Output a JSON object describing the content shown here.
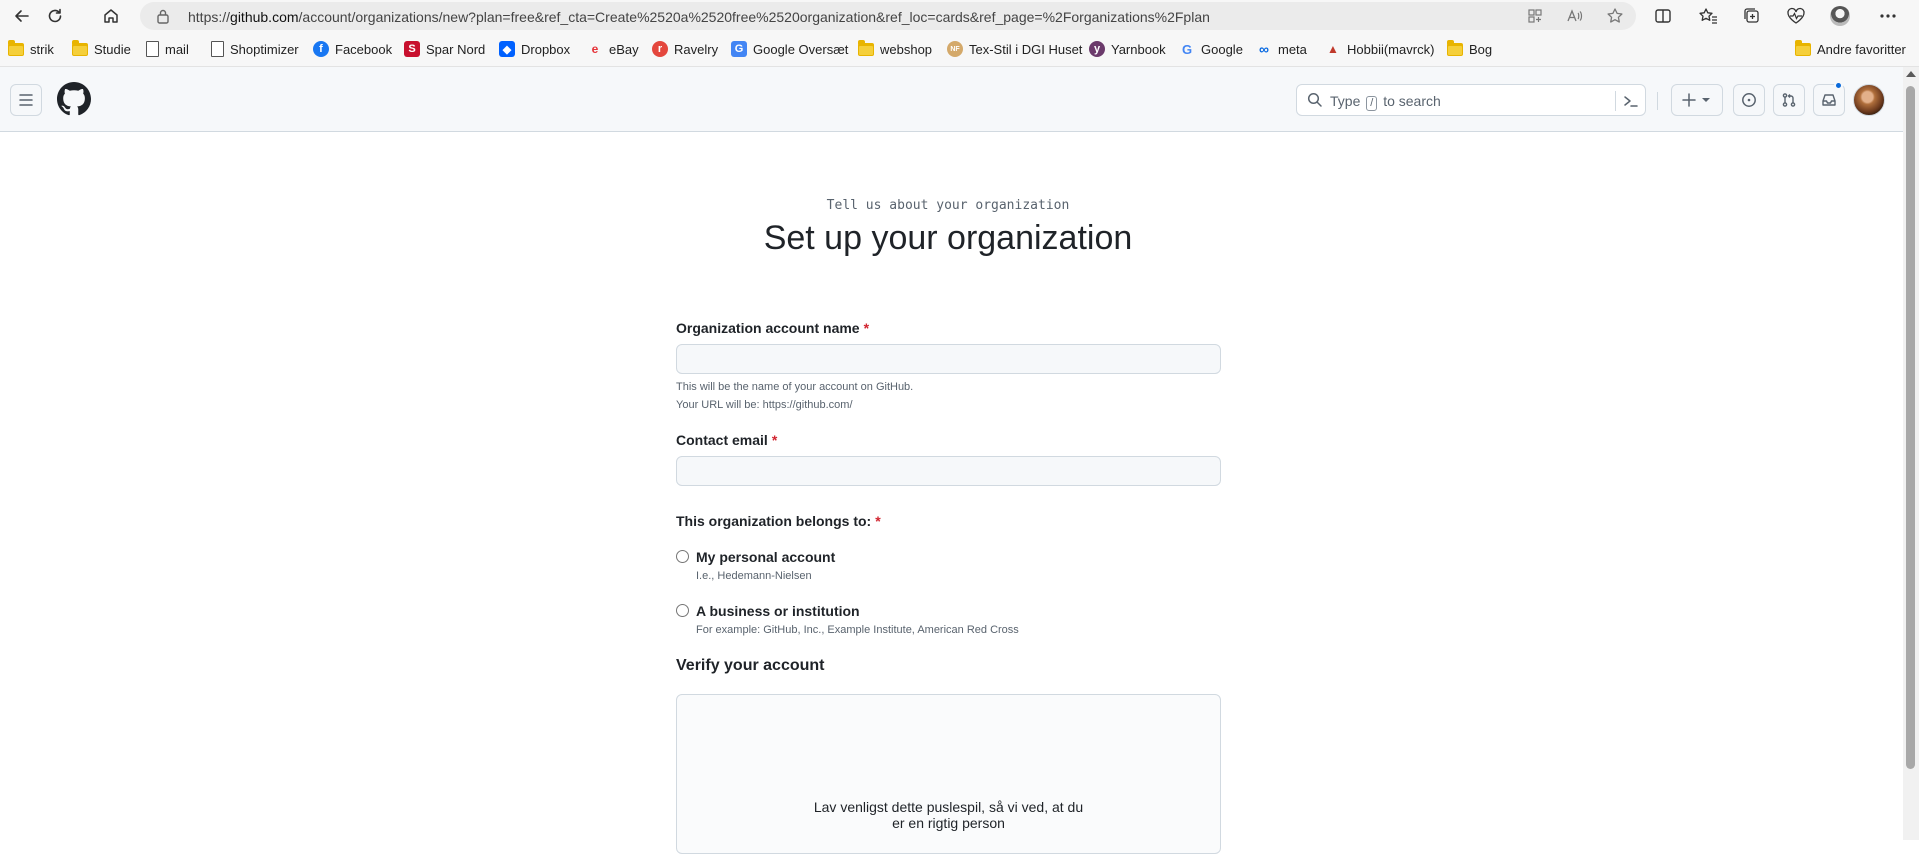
{
  "browser": {
    "url_prefix": "https://",
    "url_host": "github.com",
    "url_path": "/account/organizations/new?plan=free&ref_cta=Create%2520a%2520free%2520organization&ref_loc=cards&ref_page=%2Forganizations%2Fplan",
    "bookmarks": [
      {
        "label": "strik",
        "icon": "folder-icon"
      },
      {
        "label": "Studie",
        "icon": "folder-icon"
      },
      {
        "label": "mail",
        "icon": "page-icon"
      },
      {
        "label": "Shoptimizer",
        "icon": "page-icon"
      },
      {
        "label": "Facebook",
        "icon": "facebook-icon",
        "color": "#1877f2"
      },
      {
        "label": "Spar Nord",
        "icon": "sparnord-icon",
        "color": "#c8102e"
      },
      {
        "label": "Dropbox",
        "icon": "dropbox-icon",
        "color": "#0061ff"
      },
      {
        "label": "eBay",
        "icon": "ebay-icon"
      },
      {
        "label": "Ravelry",
        "icon": "ravelry-icon",
        "color": "#e4473d"
      },
      {
        "label": "Google Oversæt",
        "icon": "google-translate-icon",
        "color": "#4285f4"
      },
      {
        "label": "webshop",
        "icon": "folder-icon"
      },
      {
        "label": "Tex-Stil i DGI Huset",
        "icon": "texstil-icon",
        "color": "#d4a96a"
      },
      {
        "label": "Yarnbook",
        "icon": "yarnbook-icon",
        "color": "#6b3a6b"
      },
      {
        "label": "Google",
        "icon": "google-icon"
      },
      {
        "label": "meta",
        "icon": "meta-icon",
        "color": "#0668e1"
      },
      {
        "label": "Hobbii(mavrck)",
        "icon": "hobbii-icon",
        "color": "#c0392b"
      },
      {
        "label": "Bog",
        "icon": "folder-icon"
      }
    ],
    "other_favorites": "Andre favoritter"
  },
  "header": {
    "search_before": "Type",
    "search_key": "/",
    "search_after": "to search"
  },
  "main": {
    "subtitle": "Tell us about your organization",
    "title": "Set up your organization",
    "org_name_label": "Organization account name",
    "org_name_value": "",
    "org_name_note_1": "This will be the name of your account on GitHub.",
    "org_name_note_2": "Your URL will be: https://github.com/",
    "email_label": "Contact email",
    "email_value": "",
    "belongs_label": "This organization belongs to:",
    "required_mark": "*",
    "option_personal_label": "My personal account",
    "option_personal_note": "I.e., Hedemann-Nielsen",
    "option_business_label": "A business or institution",
    "option_business_note": "For example: GitHub, Inc., Example Institute, American Red Cross",
    "verify_title": "Verify your account",
    "captcha_text": "Lav venligst dette puslespil, så vi ved, at du er en rigtig person"
  },
  "colors": {
    "required": "#d1242f",
    "notification_dot": "#0969da"
  }
}
